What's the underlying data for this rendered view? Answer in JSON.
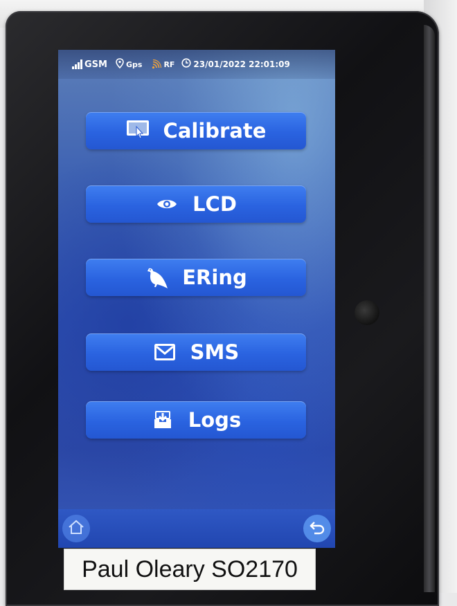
{
  "status": {
    "gsm_label": "GSM",
    "gps_label": "Gps",
    "rf_label": "RF",
    "datetime": "23/01/2022 22:01:09"
  },
  "menu": [
    {
      "label": "Calibrate",
      "icon": "calibrate-icon"
    },
    {
      "label": "LCD",
      "icon": "eye-icon"
    },
    {
      "label": "ERing",
      "icon": "pigeon-icon"
    },
    {
      "label": "SMS",
      "icon": "envelope-icon"
    },
    {
      "label": "Logs",
      "icon": "logs-download-icon"
    }
  ],
  "nav": {
    "home_icon": "home-icon",
    "back_icon": "back-arrow-icon"
  },
  "sticker": {
    "text": "Paul Oleary SO2170"
  },
  "colors": {
    "button": "#2a63e0",
    "rf_icon": "#f0a23a"
  }
}
